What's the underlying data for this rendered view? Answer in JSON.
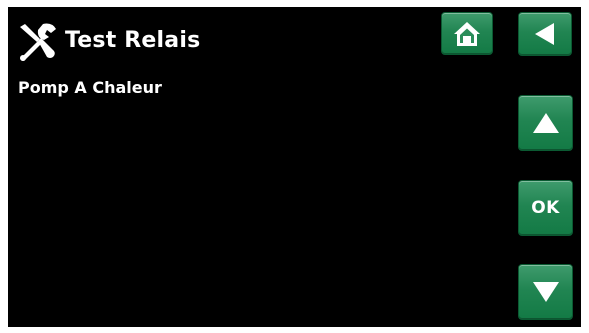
{
  "header": {
    "title": "Test Relais",
    "icon": "tools-icon"
  },
  "main": {
    "subtitle": "Pomp A Chaleur"
  },
  "buttons": {
    "home_icon": "home-icon",
    "back_icon": "arrow-left-icon",
    "up_icon": "arrow-up-icon",
    "ok_label": "OK",
    "down_icon": "arrow-down-icon"
  },
  "colors": {
    "background": "#000000",
    "button": "#218552",
    "text": "#ffffff"
  }
}
